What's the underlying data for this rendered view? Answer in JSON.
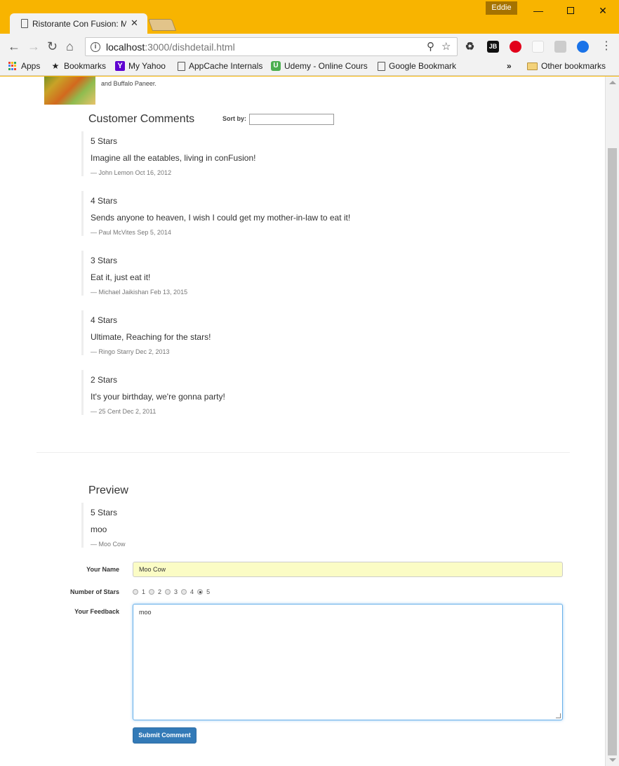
{
  "window": {
    "profile_name": "Eddie",
    "tab_title": "Ristorante Con Fusion: Menu"
  },
  "toolbar": {
    "url_host": "localhost",
    "url_port_path": ":3000/dishdetail.html"
  },
  "bookmarks": {
    "items": [
      {
        "label": "Apps",
        "icon": "apps-grid-icon"
      },
      {
        "label": "Bookmarks",
        "icon": "star-icon"
      },
      {
        "label": "My Yahoo",
        "icon": "yahoo-icon"
      },
      {
        "label": "AppCache Internals",
        "icon": "page-icon"
      },
      {
        "label": "Udemy - Online Cours",
        "icon": "udemy-icon"
      },
      {
        "label": "Google Bookmark",
        "icon": "page-icon"
      }
    ],
    "overflow": "»",
    "other_label": "Other bookmarks"
  },
  "dish": {
    "description_tail": "and Buffalo Paneer."
  },
  "comments": {
    "title": "Customer Comments",
    "sort_label": "Sort by:",
    "sort_value": "",
    "items": [
      {
        "rating": "5 Stars",
        "text": "Imagine all the eatables, living in conFusion!",
        "author": "— John Lemon Oct 16, 2012"
      },
      {
        "rating": "4 Stars",
        "text": "Sends anyone to heaven, I wish I could get my mother-in-law to eat it!",
        "author": "— Paul McVites Sep 5, 2014"
      },
      {
        "rating": "3 Stars",
        "text": "Eat it, just eat it!",
        "author": "— Michael Jaikishan Feb 13, 2015"
      },
      {
        "rating": "4 Stars",
        "text": "Ultimate, Reaching for the stars!",
        "author": "— Ringo Starry Dec 2, 2013"
      },
      {
        "rating": "2 Stars",
        "text": "It's your birthday, we're gonna party!",
        "author": "— 25 Cent Dec 2, 2011"
      }
    ]
  },
  "preview": {
    "title": "Preview",
    "rating": "5 Stars",
    "text": "moo",
    "author": "— Moo Cow"
  },
  "form": {
    "name_label": "Your Name",
    "name_value": "Moo Cow",
    "stars_label": "Number of Stars",
    "star_options": [
      "1",
      "2",
      "3",
      "4",
      "5"
    ],
    "selected_star": "5",
    "feedback_label": "Your Feedback",
    "feedback_value": "moo",
    "submit_label": "Submit Comment"
  }
}
